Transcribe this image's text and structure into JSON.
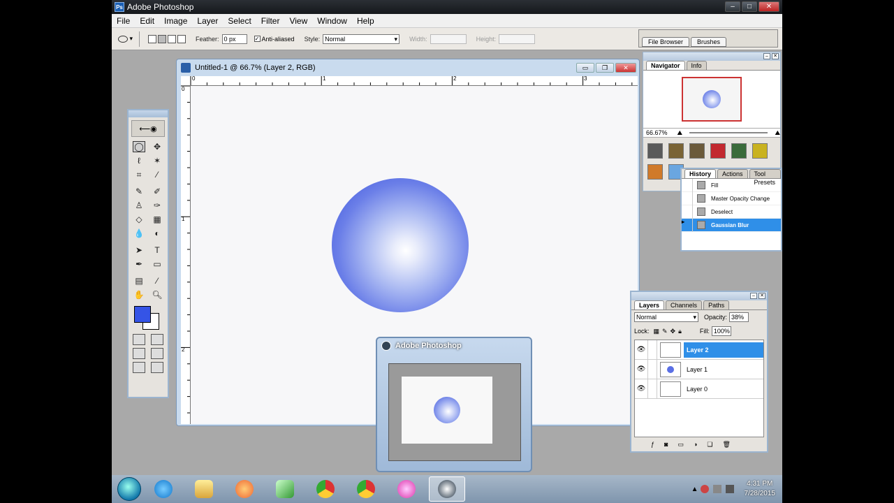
{
  "app": {
    "title": "Adobe Photoshop",
    "icon": "photoshop-icon"
  },
  "menu": [
    "File",
    "Edit",
    "Image",
    "Layer",
    "Select",
    "Filter",
    "View",
    "Window",
    "Help"
  ],
  "options": {
    "feather_label": "Feather:",
    "feather_value": "0 px",
    "anti_aliased_label": "Anti-aliased",
    "anti_aliased_checked": true,
    "style_label": "Style:",
    "style_value": "Normal",
    "width_label": "Width:",
    "height_label": "Height:",
    "palette_tabs": [
      "File Browser",
      "Brushes"
    ]
  },
  "document": {
    "title": "Untitled-1 @ 66.7% (Layer 2, RGB)",
    "ruler_h_marks": [
      "0",
      "1",
      "2",
      "3"
    ],
    "ruler_v_marks": [
      "0",
      "1",
      "2"
    ],
    "foreground_color": "#3554e6",
    "background_color": "#ffffff"
  },
  "navigator": {
    "tabs": [
      "Navigator",
      "Info"
    ],
    "zoom": "66.67%",
    "swatches": [
      "#5a5a5a",
      "#7a6334",
      "#6b5a3a",
      "#c2292f",
      "#3a6b3a",
      "#c9b21f",
      "#d07a2a",
      "#6aa6e0"
    ]
  },
  "history": {
    "tabs": [
      "History",
      "Actions",
      "Tool Presets"
    ],
    "items": [
      "Fill",
      "Master Opacity Change",
      "Deselect",
      "Gaussian Blur"
    ],
    "active_index": 3
  },
  "layers": {
    "tabs": [
      "Layers",
      "Channels",
      "Paths"
    ],
    "blend_mode": "Normal",
    "opacity_label": "Opacity:",
    "opacity": "38%",
    "lock_label": "Lock:",
    "fill_label": "Fill:",
    "fill": "100%",
    "items": [
      "Layer 2",
      "Layer 1",
      "Layer 0"
    ],
    "active_index": 0
  },
  "preview": {
    "title": "Adobe Photoshop"
  },
  "taskbar": {
    "apps": [
      "start-orb",
      "internet-explorer-icon",
      "file-explorer-icon",
      "media-player-icon",
      "paint-icon",
      "chrome-icon",
      "chrome-icon",
      "flower-app-icon",
      "photoshop-icon"
    ],
    "time": "4:31 PM",
    "date": "7/28/2015"
  }
}
